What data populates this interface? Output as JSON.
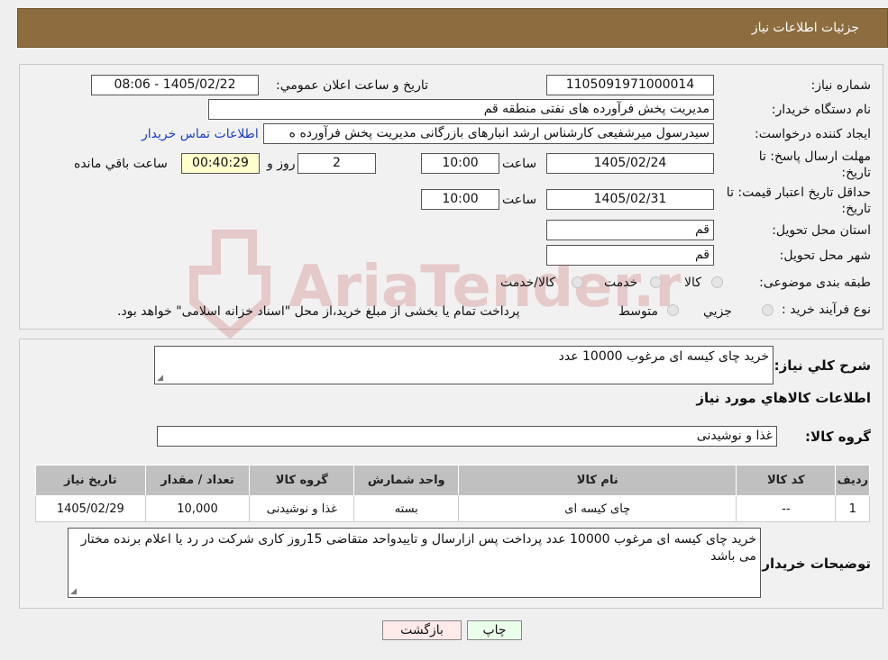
{
  "header": {
    "title": "جزئيات اطلاعات نياز"
  },
  "form": {
    "need_number_label": "شماره نياز:",
    "need_number": "1105091971000014",
    "announce_label": "تاريخ و ساعت اعلان عمومي:",
    "announce_value": "1405/02/22 - 08:06",
    "buyer_org_label": "نام دستگاه خريدار:",
    "buyer_org": "مدیریت پخش فرآورده های نفتی منطقه قم",
    "creator_label": "ايجاد کننده درخواست:",
    "creator": "سیدرسول میرشفیعی کارشناس ارشد انبارهای بازرگانی مدیریت پخش فرآورده ه",
    "contact_link": "اطلاعات تماس خريدار",
    "deadline_label_1": "مهلت ارسال پاسخ: تا",
    "deadline_label_2": "تاريخ:",
    "deadline_date": "1405/02/24",
    "time_label": "ساعت",
    "deadline_time": "10:00",
    "days_value": "2",
    "days_label": "روز و",
    "remaining_time": "00:40:29",
    "remaining_label": "ساعت باقي مانده",
    "price_label_1": "حداقل تاريخ اعتبار قيمت: تا",
    "price_label_2": "تاريخ:",
    "price_date": "1405/02/31",
    "price_time": "10:00",
    "province_label": "استان محل تحويل:",
    "province": "قم",
    "city_label": "شهر محل تحويل:",
    "city": "قم",
    "category_label": "طبقه بندی موضوعی:",
    "category_opt1": "کالا",
    "category_opt2": "خدمت",
    "category_opt3": "کالا/خدمت",
    "process_label": "نوع فرآيند خريد :",
    "process_opt1": "جزيي",
    "process_opt2": "متوسط",
    "process_note": "پرداخت تمام یا بخشی از مبلغ خرید،از محل \"اسناد خزانه اسلامی\" خواهد بود."
  },
  "details": {
    "summary_label": "شرح كلي نياز:",
    "summary": "خرید چای کیسه ای مرغوب 10000 عدد",
    "items_title": "اطلاعات كالاهاي مورد نياز",
    "group_label": "گروه كالا:",
    "group": "غذا و نوشیدنی",
    "table": {
      "headers": [
        "رديف",
        "كد كالا",
        "نام كالا",
        "واحد شمارش",
        "گروه كالا",
        "تعداد / مقدار",
        "تاريخ نياز"
      ],
      "rows": [
        [
          "1",
          "--",
          "چای کیسه ای",
          "بسته",
          "غذا و نوشیدنی",
          "10,000",
          "1405/02/29"
        ]
      ]
    },
    "buyer_notes_label": "توضيحات خريدار:",
    "buyer_notes": "خرید چای کیسه ای مرغوب 10000 عدد پرداخت پس ازارسال و تاییدواحد متقاضی 15روز کاری  شرکت در رد یا اعلام برنده مختار می باشد"
  },
  "buttons": {
    "print": "چاپ",
    "back": "بازگشت"
  },
  "watermark": {
    "text": "AriaTender.neT"
  },
  "colors": {
    "header_bg": "#8d6d3f",
    "link": "#1a3fcc",
    "print_bg": "#eaffea",
    "back_bg": "#ffe9e9"
  }
}
